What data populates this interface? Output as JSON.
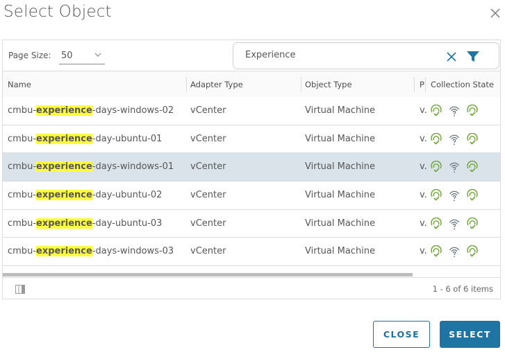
{
  "dialog": {
    "title": "Select Object",
    "close_icon": "close-icon"
  },
  "toolbar": {
    "page_size_label": "Page Size:",
    "page_size_value": "50",
    "search_value": "Experience",
    "search_clear_icon": "close-icon",
    "filter_icon": "filter-icon",
    "accent_color": "#1e74a3"
  },
  "table": {
    "columns": [
      "Name",
      "Adapter Type",
      "Object Type",
      "P",
      "Collection State"
    ],
    "highlight_term": "experience",
    "rows": [
      {
        "name_prefix": "cmbu-",
        "name_match": "experience",
        "name_suffix": "-days-windows-02",
        "adapter": "vCenter",
        "object_type": "Virtual Machine",
        "p": "v.",
        "selected": false,
        "states": [
          "collecting",
          "unknown",
          "collecting"
        ]
      },
      {
        "name_prefix": "cmbu-",
        "name_match": "experience",
        "name_suffix": "-day-ubuntu-01",
        "adapter": "vCenter",
        "object_type": "Virtual Machine",
        "p": "v.",
        "selected": false,
        "states": [
          "collecting",
          "unknown",
          "collecting"
        ]
      },
      {
        "name_prefix": "cmbu-",
        "name_match": "experience",
        "name_suffix": "-days-windows-01",
        "adapter": "vCenter",
        "object_type": "Virtual Machine",
        "p": "v.",
        "selected": true,
        "states": [
          "collecting",
          "unknown",
          "collecting"
        ]
      },
      {
        "name_prefix": "cmbu-",
        "name_match": "experience",
        "name_suffix": "-day-ubuntu-02",
        "adapter": "vCenter",
        "object_type": "Virtual Machine",
        "p": "v.",
        "selected": false,
        "states": [
          "collecting",
          "unknown",
          "collecting"
        ]
      },
      {
        "name_prefix": "cmbu-",
        "name_match": "experience",
        "name_suffix": "-day-ubuntu-03",
        "adapter": "vCenter",
        "object_type": "Virtual Machine",
        "p": "v.",
        "selected": false,
        "states": [
          "collecting",
          "unknown",
          "collecting"
        ]
      },
      {
        "name_prefix": "cmbu-",
        "name_match": "experience",
        "name_suffix": "-days-windows-03",
        "adapter": "vCenter",
        "object_type": "Virtual Machine",
        "p": "v.",
        "selected": false,
        "states": [
          "collecting",
          "unknown",
          "collecting"
        ]
      }
    ],
    "state_colors": {
      "collecting": "#6aa531",
      "unknown": "#6a7580"
    },
    "highlight_color": "#ffff3a",
    "selected_row_color": "#dae2ea"
  },
  "footer": {
    "column_toggle_icon": "column-toggle-icon",
    "pagination_text": "1 - 6 of 6 items"
  },
  "actions": {
    "close_label": "CLOSE",
    "select_label": "SELECT"
  }
}
